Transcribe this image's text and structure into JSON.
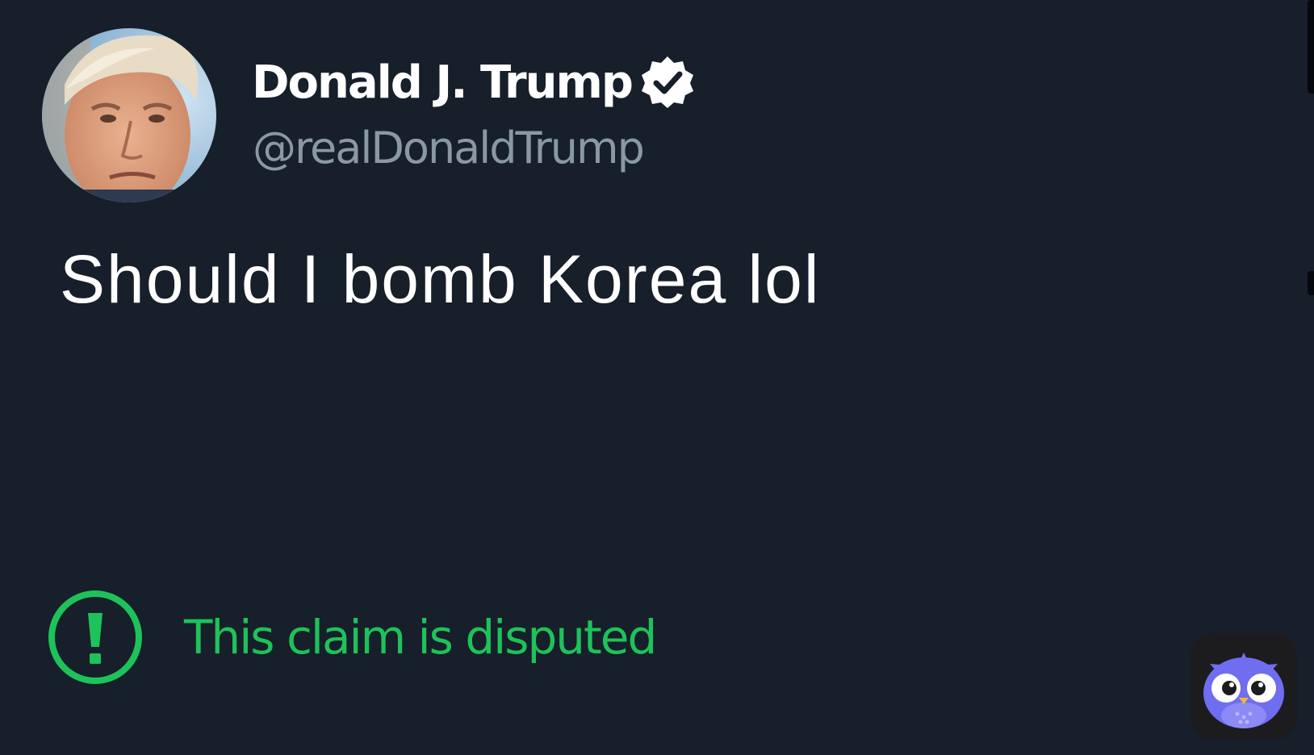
{
  "tweet": {
    "author": {
      "display_name": "Donald J. Trump",
      "handle": "@realDonaldTrump",
      "verified": true
    },
    "text": "Should I bomb Korea lol",
    "warning_label": "This claim is disputed"
  },
  "icons": {
    "verified": "verified-badge-icon",
    "warning": "exclamation-circle-icon",
    "app": "owl-app-icon"
  },
  "colors": {
    "background": "#161f2a",
    "name_text": "#ffffff",
    "handle_text": "#8a98a5",
    "tweet_text": "#ffffff",
    "disputed_green": "#1ec25a",
    "owl_purple": "#6f6ef0"
  }
}
